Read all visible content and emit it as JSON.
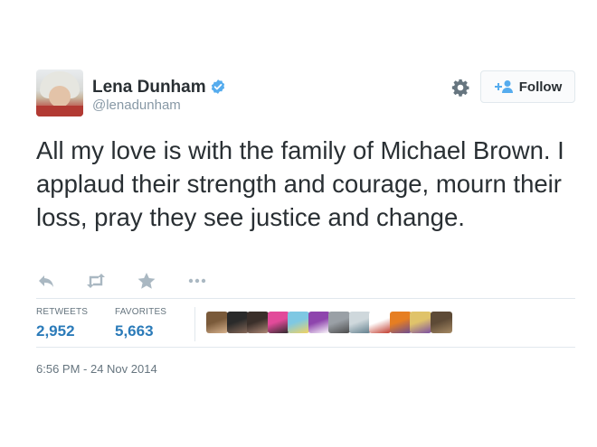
{
  "user": {
    "name": "Lena Dunham",
    "handle": "@lenadunham",
    "verified": true
  },
  "follow_button": {
    "label": "Follow"
  },
  "tweet": {
    "text": "All my love is with the family of Michael Brown. I applaud their strength and courage, mourn their loss, pray they see justice and change."
  },
  "actions": [
    "reply-icon",
    "retweet-icon",
    "favorite-icon",
    "more-icon"
  ],
  "stats": {
    "retweets_label": "RETWEETS",
    "retweets_count": "2,952",
    "favorites_label": "FAVORITES",
    "favorites_count": "5,663"
  },
  "timestamp": "6:56 PM - 24 Nov 2014",
  "colors": {
    "link_blue": "#2b7bb9",
    "verified_blue": "#55acee",
    "text": "#292f33",
    "muted": "#8899a6"
  },
  "favoriters": [
    {
      "colors": [
        "#7a5a3a",
        "#d9b48f"
      ]
    },
    {
      "colors": [
        "#2a2a2a",
        "#8a6b5a"
      ]
    },
    {
      "colors": [
        "#3a2f2a",
        "#b08a78"
      ]
    },
    {
      "colors": [
        "#e24a9a",
        "#2a2a2a"
      ]
    },
    {
      "colors": [
        "#7ec8e3",
        "#f4d35e"
      ]
    },
    {
      "colors": [
        "#8e44ad",
        "#ffffff"
      ]
    },
    {
      "colors": [
        "#9aa0a6",
        "#4a4a4a"
      ]
    },
    {
      "colors": [
        "#cfd8dc",
        "#607d8b"
      ]
    },
    {
      "colors": [
        "#ffffff",
        "#c0392b"
      ]
    },
    {
      "colors": [
        "#e67e22",
        "#6a4c93"
      ]
    },
    {
      "colors": [
        "#e0c36a",
        "#7a4ea3"
      ]
    },
    {
      "colors": [
        "#5d4a36",
        "#a68a64"
      ]
    }
  ]
}
